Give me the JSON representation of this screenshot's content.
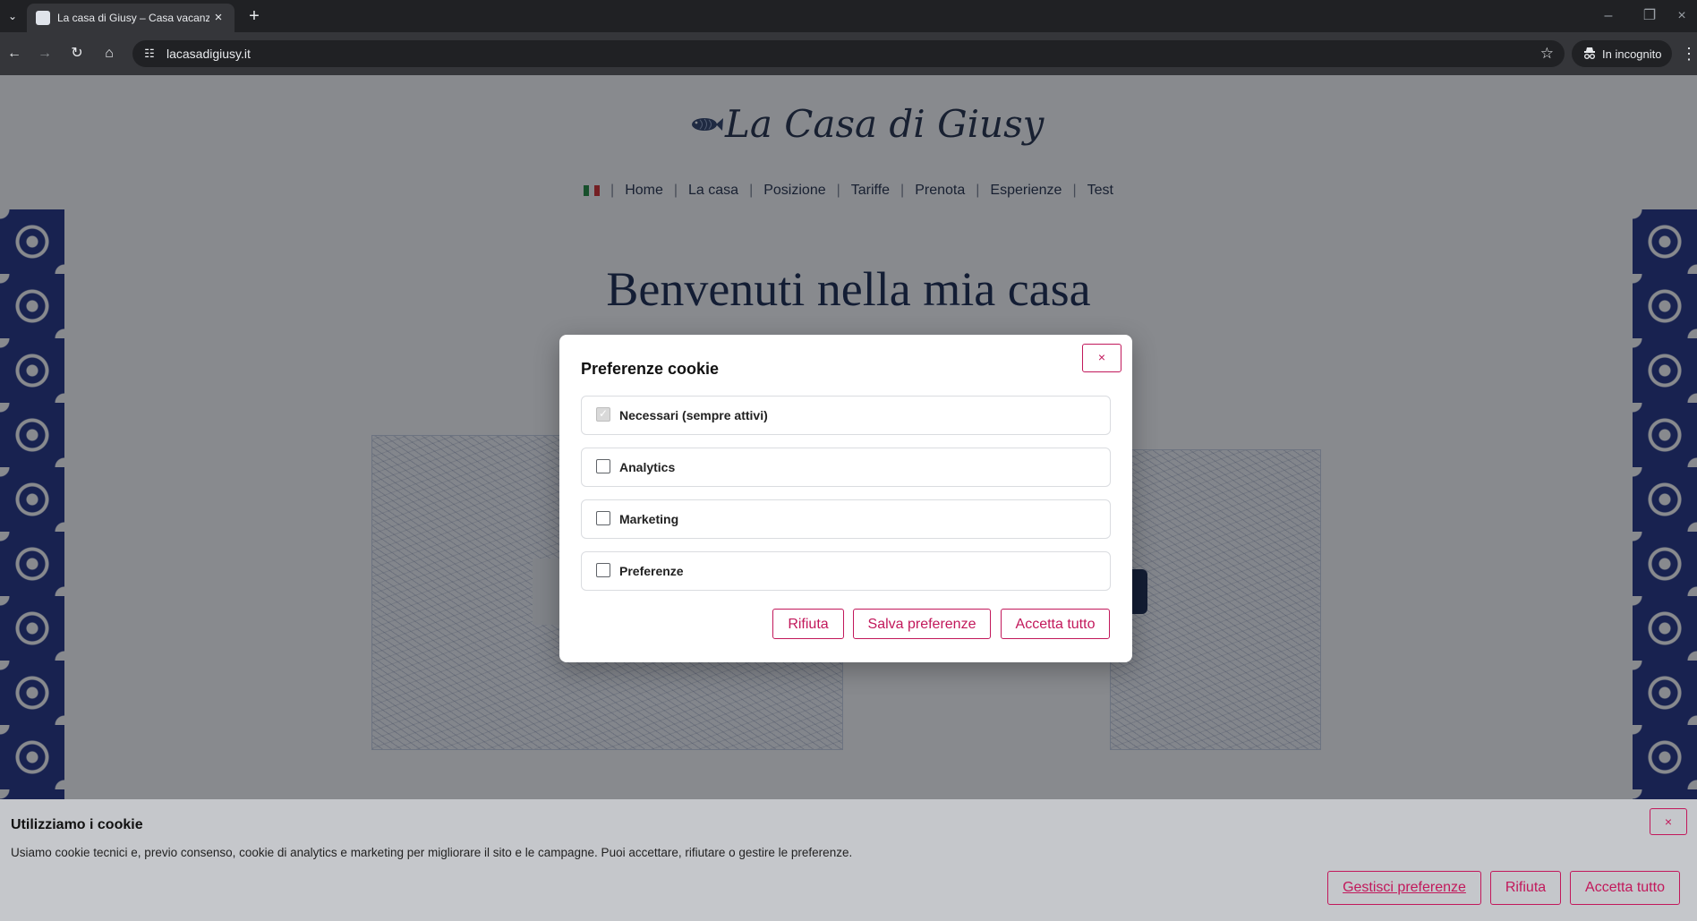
{
  "browser": {
    "tab_title": "La casa di Giusy – Casa vacanze",
    "url": "lacasadigiusy.it",
    "incognito_label": "In incognito"
  },
  "site": {
    "logo_text": "La Casa di Giusy",
    "nav": [
      "Home",
      "La casa",
      "Posizione",
      "Tariffe",
      "Prenota",
      "Esperienze",
      "Test"
    ],
    "hero_title": "Benvenuti nella mia casa"
  },
  "modal": {
    "title": "Preferenze cookie",
    "close": "×",
    "options": [
      {
        "label": "Necessari (sempre attivi)",
        "checked": true,
        "disabled": true
      },
      {
        "label": "Analytics",
        "checked": false
      },
      {
        "label": "Marketing",
        "checked": false
      },
      {
        "label": "Preferenze",
        "checked": false
      }
    ],
    "buttons": {
      "reject": "Rifiuta",
      "save": "Salva preferenze",
      "accept": "Accetta tutto"
    }
  },
  "banner": {
    "title": "Utilizziamo i cookie",
    "text": "Usiamo cookie tecnici e, previo consenso, cookie di analytics e marketing per migliorare il sito e le campagne. Puoi accettare, rifiutare o gestire le preferenze.",
    "close": "×",
    "buttons": {
      "manage": "Gestisci preferenze",
      "reject": "Rifiuta",
      "accept": "Accetta tutto"
    }
  },
  "colors": {
    "accent": "#c2185b",
    "navy": "#14244a",
    "tile_blue": "#1e2f82"
  }
}
